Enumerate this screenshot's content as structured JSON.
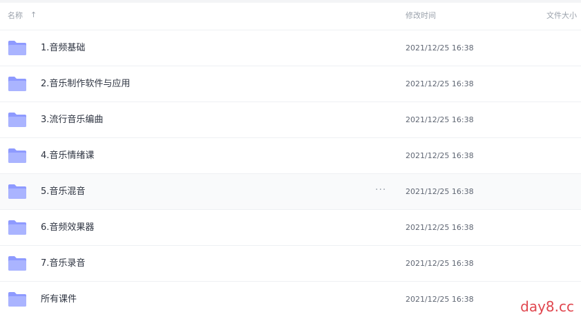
{
  "header": {
    "name_label": "名称",
    "sort_icon": "↑",
    "modified_label": "修改时间",
    "size_label": "文件大小"
  },
  "colors": {
    "folder_light": "#b9c2ff",
    "folder_dark": "#7f8cff",
    "watermark": "#e0464e"
  },
  "files": [
    {
      "name": "1.音频基础",
      "modified": "2021/12/25 16:38",
      "icon": "folder-icon"
    },
    {
      "name": "2.音乐制作软件与应用",
      "modified": "2021/12/25 16:38",
      "icon": "folder-icon"
    },
    {
      "name": "3.流行音乐编曲",
      "modified": "2021/12/25 16:38",
      "icon": "folder-icon"
    },
    {
      "name": "4.音乐情绪课",
      "modified": "2021/12/25 16:38",
      "icon": "folder-icon"
    },
    {
      "name": "5.音乐混音",
      "modified": "2021/12/25 16:38",
      "icon": "folder-icon",
      "hovered": true,
      "more": "···"
    },
    {
      "name": "6.音频效果器",
      "modified": "2021/12/25 16:38",
      "icon": "folder-icon"
    },
    {
      "name": "7.音乐录音",
      "modified": "2021/12/25 16:38",
      "icon": "folder-icon"
    },
    {
      "name": "所有课件",
      "modified": "2021/12/25 16:38",
      "icon": "folder-icon"
    }
  ],
  "watermark": "day8.cc"
}
